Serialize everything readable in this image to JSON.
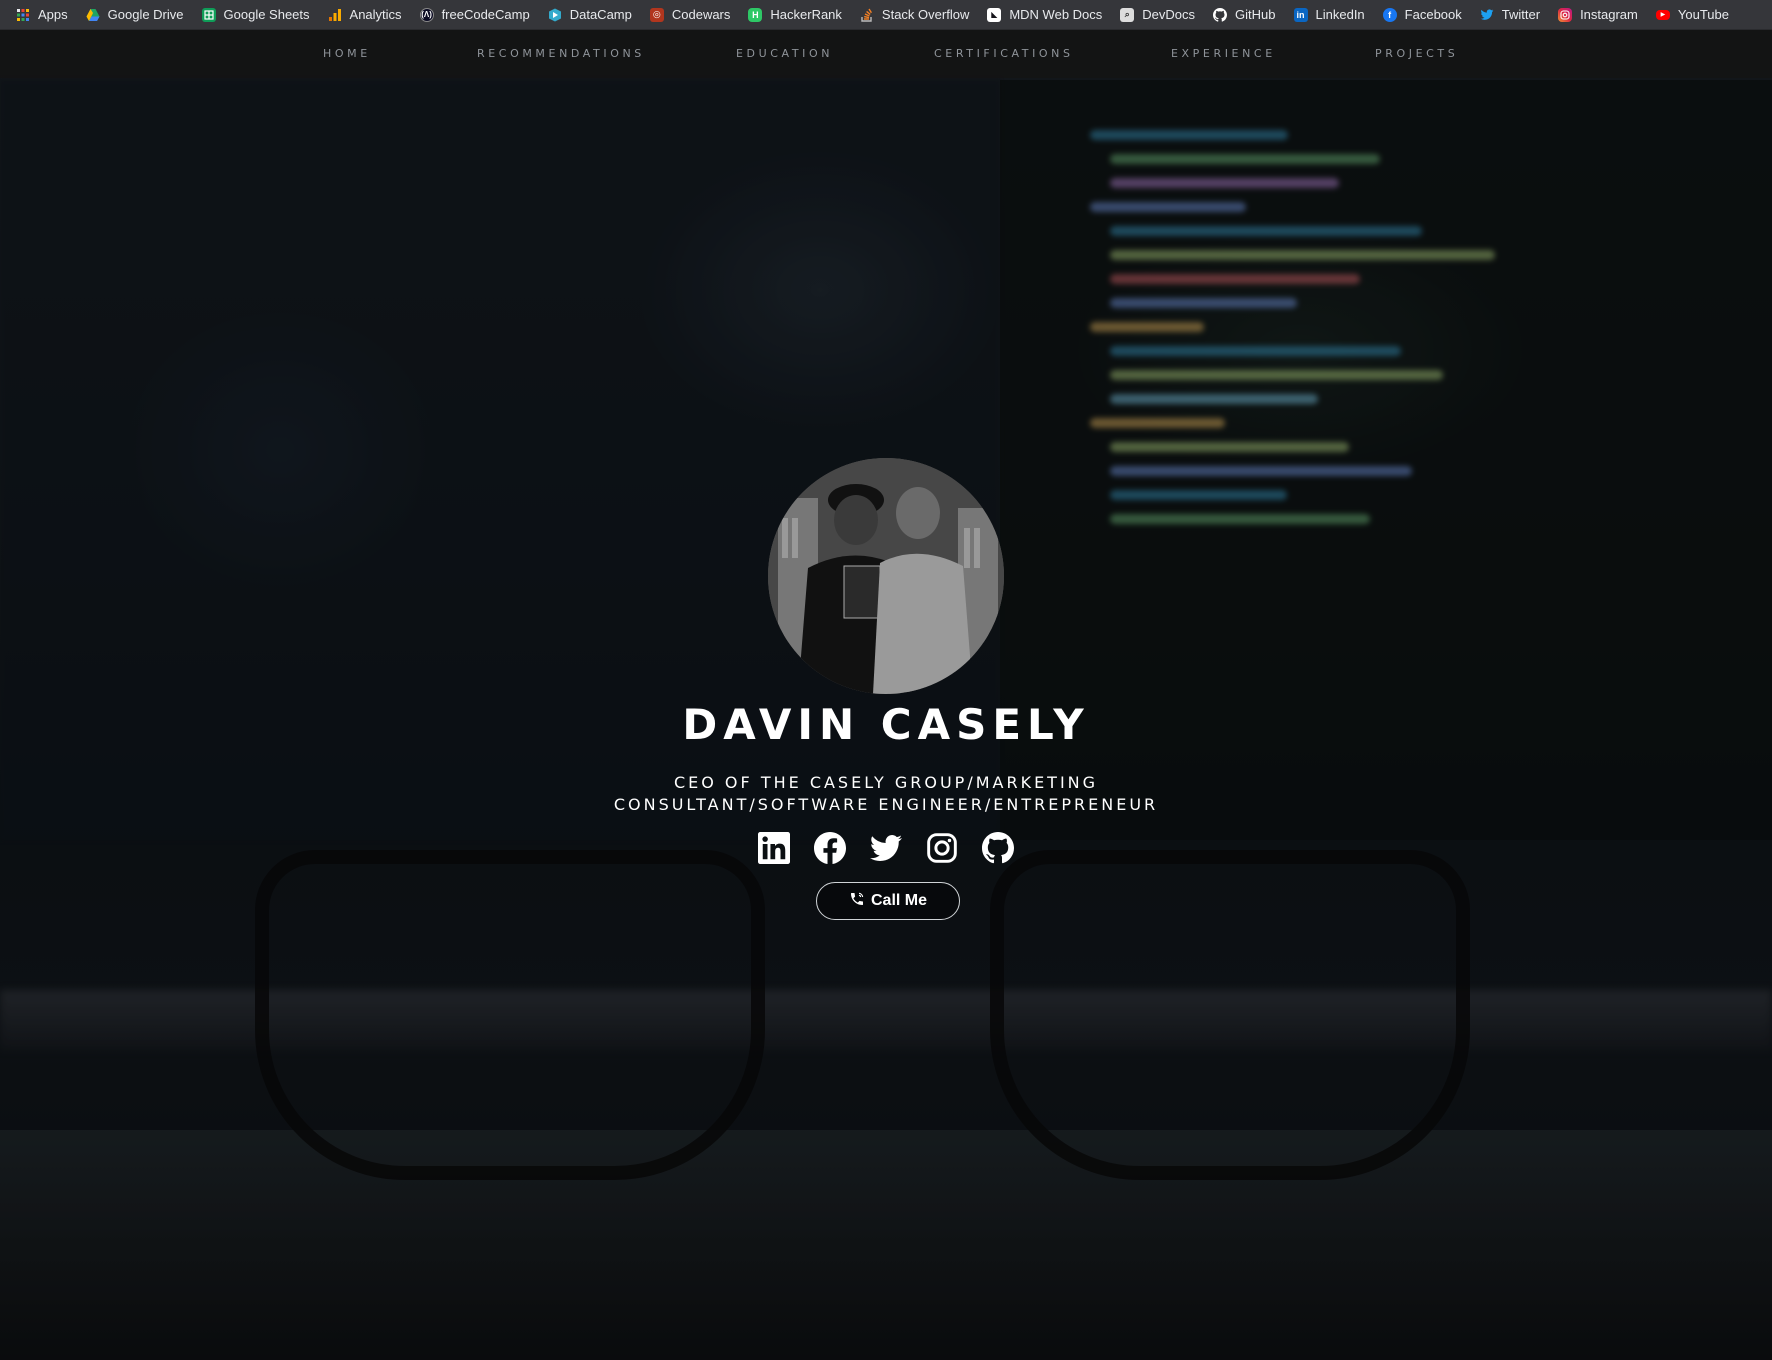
{
  "bookmarks": [
    {
      "label": "Apps",
      "icon": "apps-grid-icon",
      "color": "#e8eaed"
    },
    {
      "label": "Google Drive",
      "icon": "google-drive-icon",
      "color": "#1fa463"
    },
    {
      "label": "Google Sheets",
      "icon": "google-sheets-icon",
      "color": "#0f9d58"
    },
    {
      "label": "Analytics",
      "icon": "analytics-icon",
      "color": "#f9ab00"
    },
    {
      "label": "freeCodeCamp",
      "icon": "freecodecamp-icon",
      "color": "#0a0a23"
    },
    {
      "label": "DataCamp",
      "icon": "datacamp-icon",
      "color": "#33aacc"
    },
    {
      "label": "Codewars",
      "icon": "codewars-icon",
      "color": "#b1361e"
    },
    {
      "label": "HackerRank",
      "icon": "hackerrank-icon",
      "color": "#2ec866"
    },
    {
      "label": "Stack Overflow",
      "icon": "stackoverflow-icon",
      "color": "#f48024"
    },
    {
      "label": "MDN Web Docs",
      "icon": "mdn-icon",
      "color": "#83d0f2"
    },
    {
      "label": "DevDocs",
      "icon": "devdocs-icon",
      "color": "#dddddd"
    },
    {
      "label": "GitHub",
      "icon": "github-icon",
      "color": "#ffffff"
    },
    {
      "label": "LinkedIn",
      "icon": "linkedin-icon",
      "color": "#0a66c2"
    },
    {
      "label": "Facebook",
      "icon": "facebook-icon",
      "color": "#1877f2"
    },
    {
      "label": "Twitter",
      "icon": "twitter-icon",
      "color": "#1da1f2"
    },
    {
      "label": "Instagram",
      "icon": "instagram-icon",
      "color": "#d6249f"
    },
    {
      "label": "YouTube",
      "icon": "youtube-icon",
      "color": "#ff0000"
    }
  ],
  "nav": {
    "items": [
      "HOME",
      "RECOMMENDATIONS",
      "EDUCATION",
      "CERTIFICATIONS",
      "EXPERIENCE",
      "PROJECTS"
    ]
  },
  "profile": {
    "name": "DAVIN CASELY",
    "subtitle_line1": "CEO OF THE CASELY GROUP/MARKETING",
    "subtitle_line2": "CONSULTANT/SOFTWARE ENGINEER/ENTREPRENEUR",
    "socials": [
      "linkedin-icon",
      "facebook-icon",
      "twitter-icon",
      "instagram-icon",
      "github-icon"
    ],
    "call_label": "Call Me"
  },
  "colors": {
    "text": "#ffffff",
    "nav_text": "#8f949a",
    "bookmarks_bg": "#35363a"
  }
}
